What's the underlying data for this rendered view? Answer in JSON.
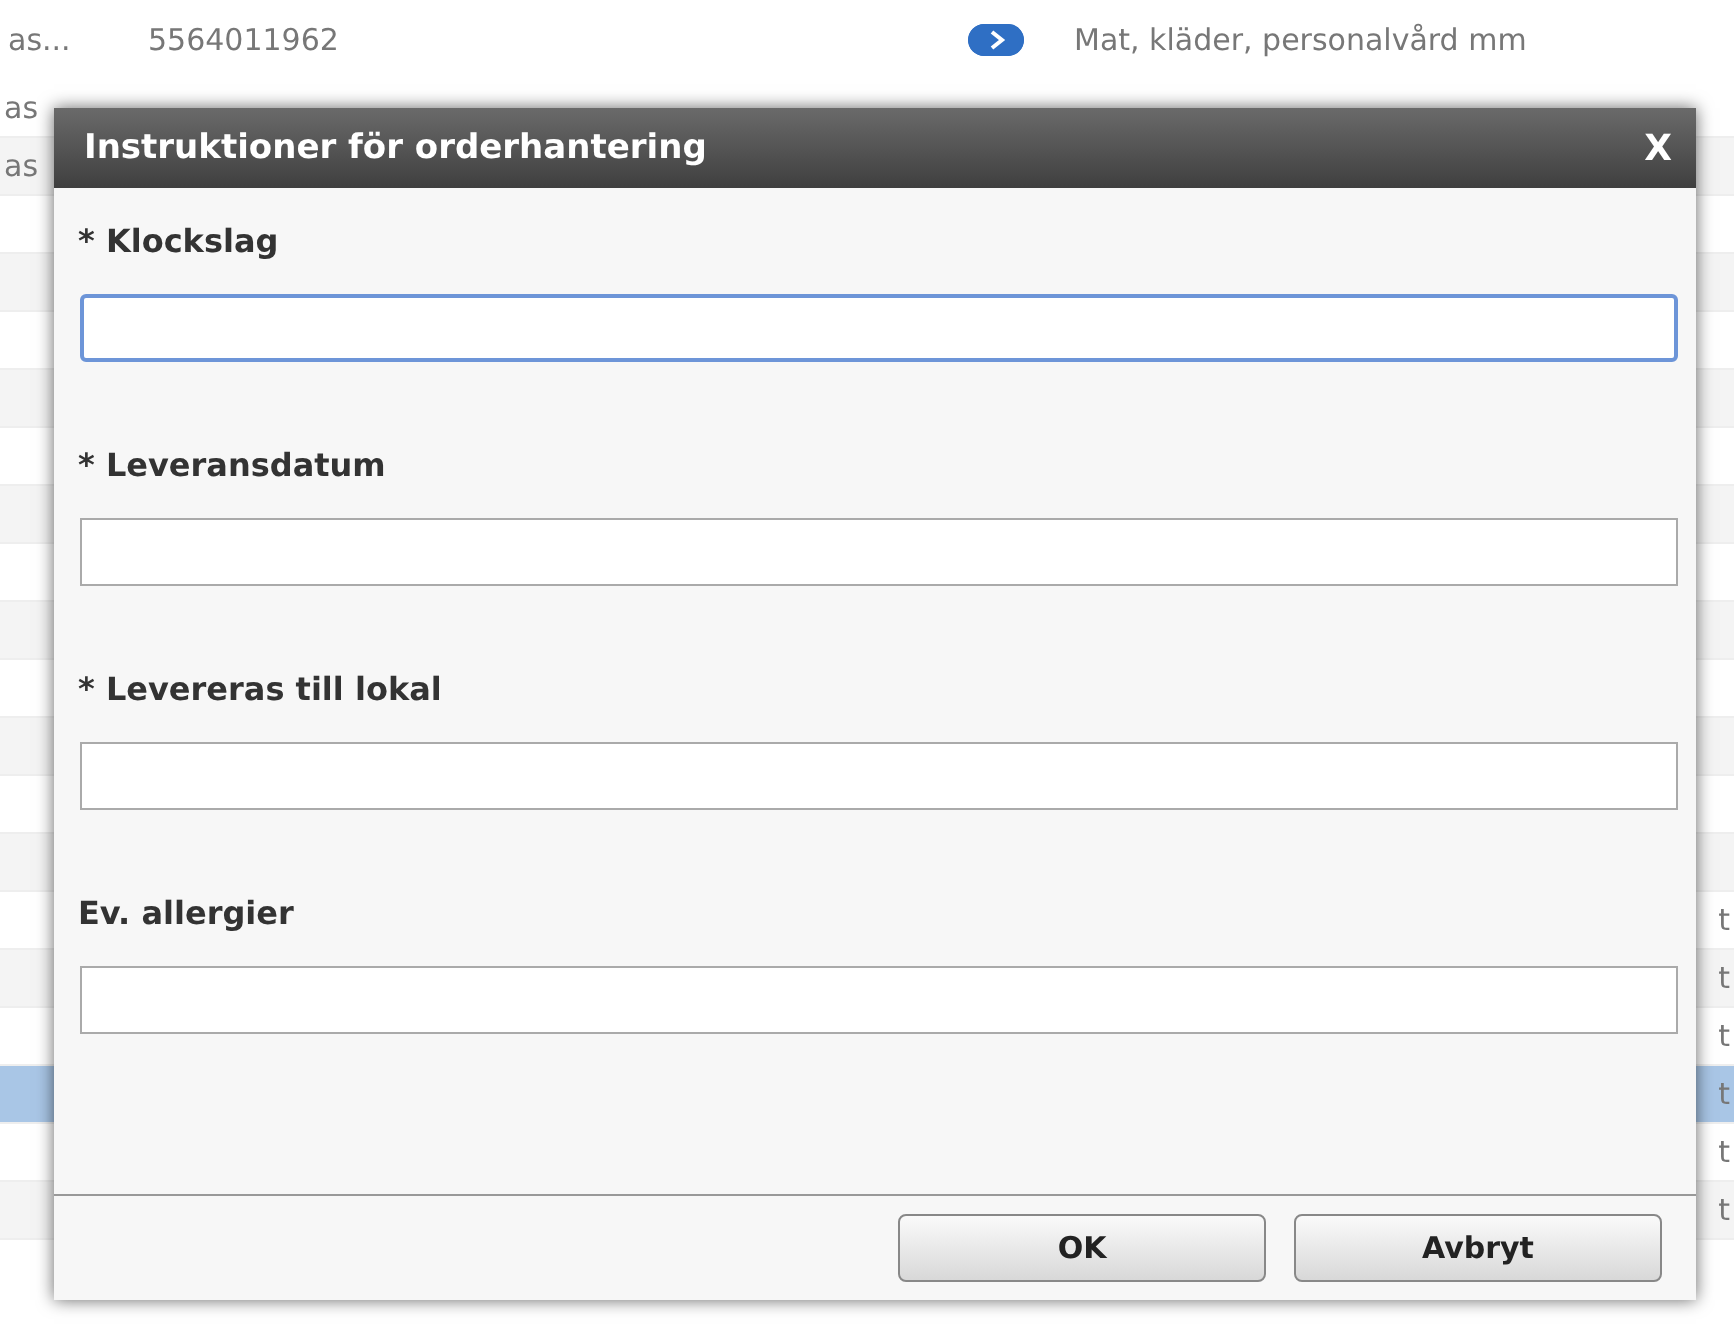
{
  "background": {
    "top_row": {
      "name": "as...",
      "number": "5564011962",
      "category": "Mat, kläder, personalvård mm"
    },
    "rows": [
      {
        "left": "as",
        "selected": false
      },
      {
        "left": "as",
        "selected": false
      },
      {
        "selected": false
      },
      {
        "selected": false
      },
      {
        "selected": false
      },
      {
        "selected": false
      },
      {
        "selected": false
      },
      {
        "selected": false
      },
      {
        "selected": false
      },
      {
        "selected": false
      },
      {
        "selected": false
      },
      {
        "selected": false
      },
      {
        "selected": false
      },
      {
        "selected": false
      },
      {
        "right": "t",
        "selected": false
      },
      {
        "right": "t",
        "selected": false
      },
      {
        "right": "t",
        "selected": false
      },
      {
        "right": "t",
        "selected": true
      },
      {
        "right": "t",
        "selected": false
      },
      {
        "right": "t",
        "selected": false
      }
    ]
  },
  "dialog": {
    "title": "Instruktioner för orderhantering",
    "close": "X",
    "fields": [
      {
        "label": "* Klockslag",
        "focused": true
      },
      {
        "label": "* Leveransdatum",
        "focused": false
      },
      {
        "label": "* Levereras till lokal",
        "focused": false
      },
      {
        "label": "Ev. allergier",
        "focused": false
      }
    ],
    "buttons": [
      "OK",
      "Avbryt"
    ]
  }
}
